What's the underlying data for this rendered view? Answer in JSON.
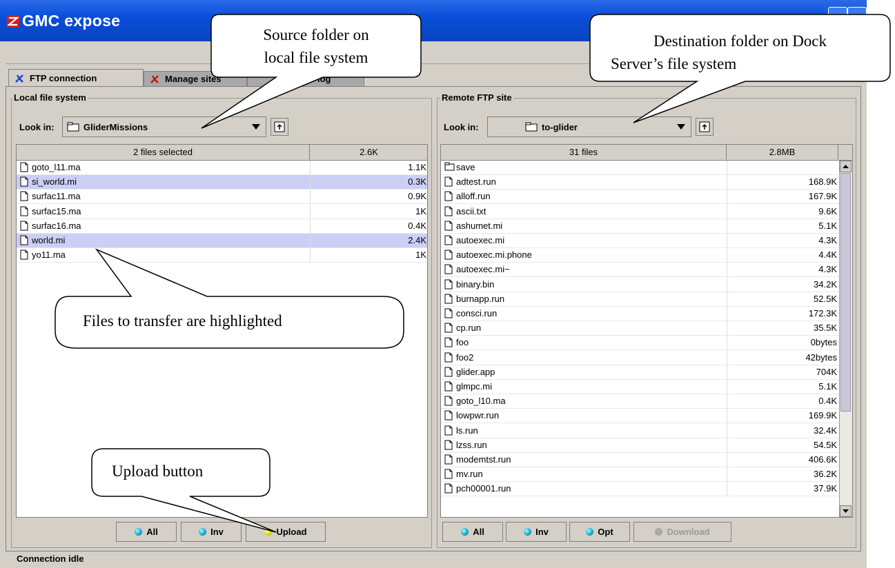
{
  "window": {
    "title": "GMC expose"
  },
  "tabs": [
    {
      "label": "FTP connection"
    },
    {
      "label": "Manage sites"
    },
    {
      "label": "View log"
    }
  ],
  "local": {
    "group_label": "Local file system",
    "lookin_label": "Look in:",
    "folder": "GliderMissions",
    "header_name": "2 files selected",
    "header_size": "2.6K",
    "files": [
      {
        "name": "goto_l11.ma",
        "size": "1.1K",
        "selected": false
      },
      {
        "name": "si_world.mi",
        "size": "0.3K",
        "selected": true
      },
      {
        "name": "surfac11.ma",
        "size": "0.9K",
        "selected": false
      },
      {
        "name": "surfac15.ma",
        "size": "1K",
        "selected": false
      },
      {
        "name": "surfac16.ma",
        "size": "0.4K",
        "selected": false
      },
      {
        "name": "world.mi",
        "size": "2.4K",
        "selected": true
      },
      {
        "name": "yo11.ma",
        "size": "1K",
        "selected": false
      }
    ],
    "buttons": {
      "all": "All",
      "inv": "Inv",
      "upload": "Upload"
    }
  },
  "remote": {
    "group_label": "Remote FTP site",
    "lookin_label": "Look in:",
    "folder": "to-glider",
    "header_name": "31 files",
    "header_size": "2.8MB",
    "files": [
      {
        "name": "save",
        "size": "",
        "type": "folder"
      },
      {
        "name": "adtest.run",
        "size": "168.9K",
        "type": "file"
      },
      {
        "name": "alloff.run",
        "size": "167.9K",
        "type": "file"
      },
      {
        "name": "ascii.txt",
        "size": "9.6K",
        "type": "file"
      },
      {
        "name": "ashumet.mi",
        "size": "5.1K",
        "type": "file"
      },
      {
        "name": "autoexec.mi",
        "size": "4.3K",
        "type": "file"
      },
      {
        "name": "autoexec.mi.phone",
        "size": "4.4K",
        "type": "file"
      },
      {
        "name": "autoexec.mi~",
        "size": "4.3K",
        "type": "file"
      },
      {
        "name": "binary.bin",
        "size": "34.2K",
        "type": "file"
      },
      {
        "name": "burnapp.run",
        "size": "52.5K",
        "type": "file"
      },
      {
        "name": "consci.run",
        "size": "172.3K",
        "type": "file"
      },
      {
        "name": "cp.run",
        "size": "35.5K",
        "type": "file"
      },
      {
        "name": "foo",
        "size": "0bytes",
        "type": "file"
      },
      {
        "name": "foo2",
        "size": "42bytes",
        "type": "file"
      },
      {
        "name": "glider.app",
        "size": "704K",
        "type": "file"
      },
      {
        "name": "glmpc.mi",
        "size": "5.1K",
        "type": "file"
      },
      {
        "name": "goto_l10.ma",
        "size": "0.4K",
        "type": "file"
      },
      {
        "name": "lowpwr.run",
        "size": "169.9K",
        "type": "file"
      },
      {
        "name": "ls.run",
        "size": "32.4K",
        "type": "file"
      },
      {
        "name": "lzss.run",
        "size": "54.5K",
        "type": "file"
      },
      {
        "name": "modemtst.run",
        "size": "406.6K",
        "type": "file"
      },
      {
        "name": "mv.run",
        "size": "36.2K",
        "type": "file"
      },
      {
        "name": "pch00001.run",
        "size": "37.9K",
        "type": "file"
      }
    ],
    "buttons": {
      "all": "All",
      "inv": "Inv",
      "opt": "Opt",
      "download": "Download"
    }
  },
  "status": "Connection idle",
  "callouts": {
    "source": [
      "Source folder on",
      "local file system"
    ],
    "destination": [
      "Destination folder on Dock",
      "Server’s file system"
    ],
    "files": "Files to transfer are highlighted",
    "upload": "Upload button"
  },
  "colors": {
    "selected_row": "#cccff5",
    "title_bar": "#0a4fd8",
    "dot_ready": "#22a8c8",
    "dot_upload": "#e8e000"
  }
}
